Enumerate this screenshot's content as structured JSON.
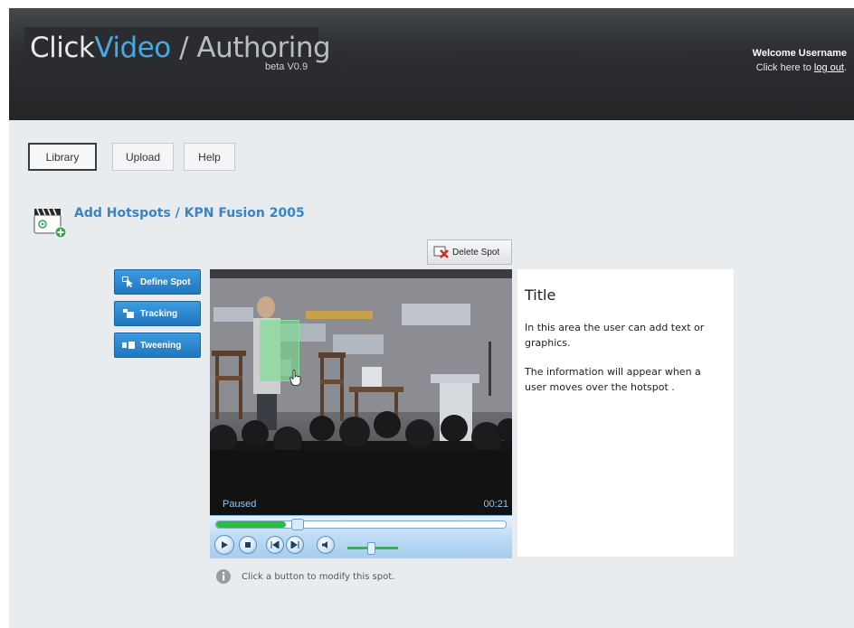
{
  "header": {
    "brand": {
      "click": "Click",
      "video": "Video",
      "separator": " / ",
      "authoring": "Authoring"
    },
    "version": "beta V0.9",
    "welcome": "Welcome Username",
    "logout_prefix": "Click here to ",
    "logout_link": "log out",
    "logout_suffix": "."
  },
  "nav": {
    "items": [
      {
        "label": "Library",
        "active": true
      },
      {
        "label": "Upload",
        "active": false
      },
      {
        "label": "Help",
        "active": false
      }
    ]
  },
  "page": {
    "title": "Add Hotspots / KPN Fusion 2005",
    "icon": "clapperboard-add-icon"
  },
  "tools": {
    "items": [
      {
        "label": "Define Spot",
        "icon": "pointer-icon"
      },
      {
        "label": "Tracking",
        "icon": "tracking-icon"
      },
      {
        "label": "Tweening",
        "icon": "tweening-icon"
      }
    ]
  },
  "delete_spot": {
    "label": "Delete Spot",
    "icon": "delete-x-icon"
  },
  "player": {
    "status": "Paused",
    "time": "00:21",
    "seek_progress": 0.24,
    "volume_level": 0.45,
    "controls": [
      "play-icon",
      "stop-icon",
      "previous-icon",
      "next-icon",
      "mute-icon"
    ]
  },
  "info_panel": {
    "title": "Title",
    "paragraphs": [
      "In this area the user can add text or graphics.",
      "The information will appear when a user moves over the hotspot ."
    ]
  },
  "hint": {
    "text": "Click a button to modify this spot.",
    "icon": "info-icon"
  },
  "colors": {
    "accent_blue": "#49a8e0",
    "button_blue": "#1f76bf",
    "hotspot_green": "#78dc8c",
    "header_dark": "#2b2d30"
  }
}
